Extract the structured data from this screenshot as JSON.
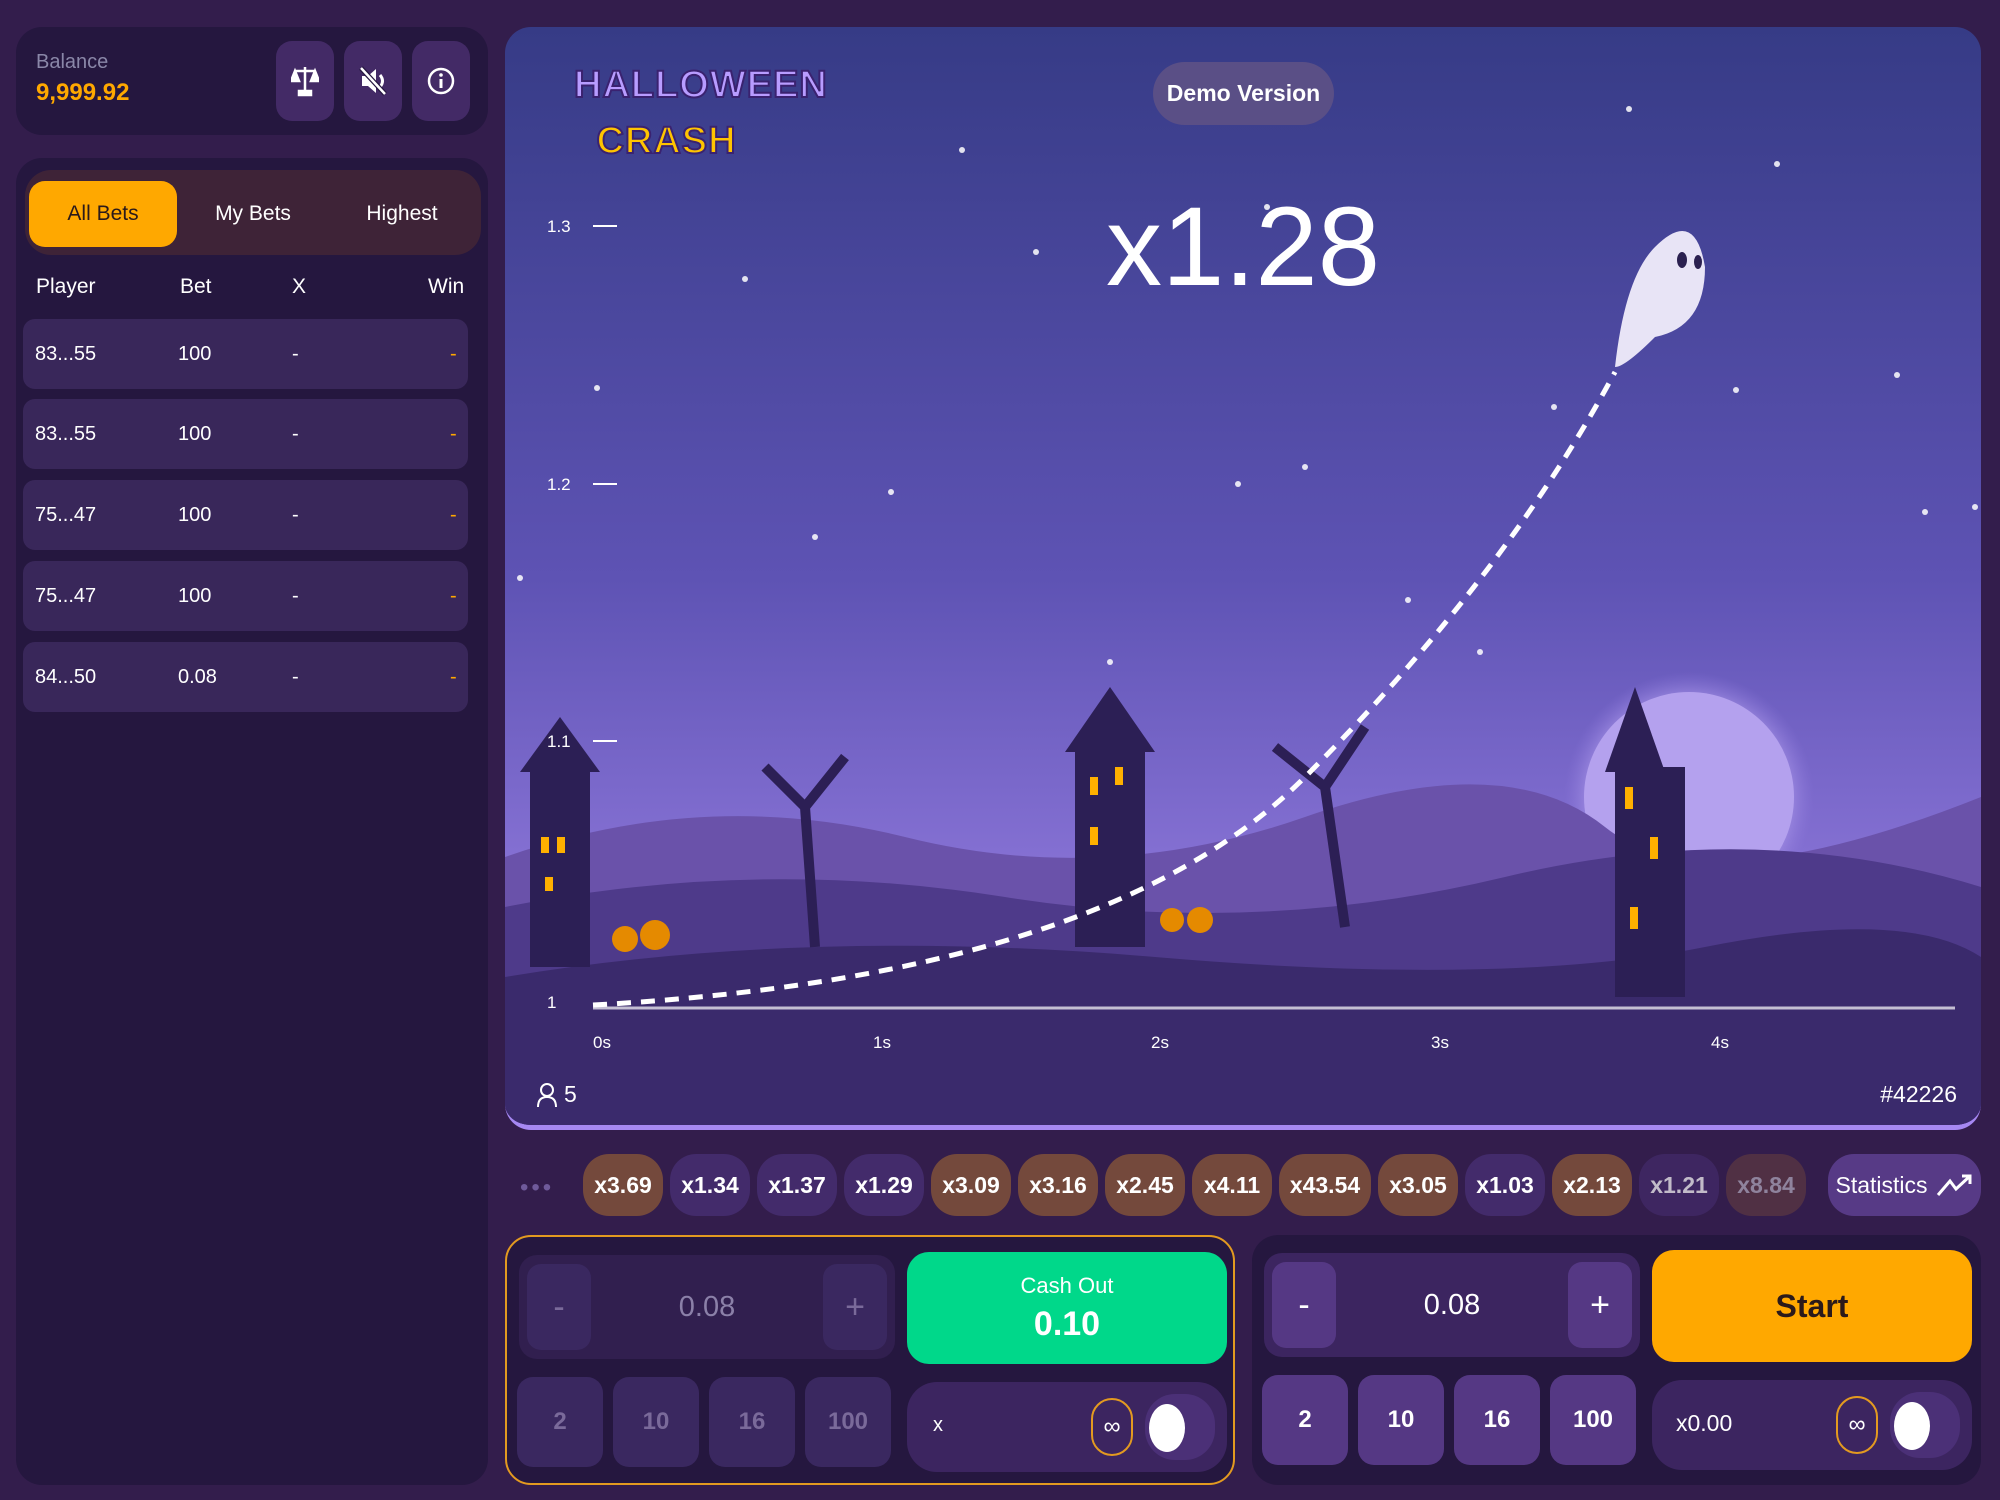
{
  "header": {
    "balance_label": "Balance",
    "balance_value": "9,999.92",
    "icons": [
      "scales-icon",
      "sound-muted-icon",
      "info-icon"
    ]
  },
  "bets": {
    "tabs": [
      {
        "label": "All Bets",
        "active": true
      },
      {
        "label": "My Bets"
      },
      {
        "label": "Highest"
      }
    ],
    "columns": [
      "Player",
      "Bet",
      "X",
      "Win"
    ],
    "rows": [
      {
        "player": "83...55",
        "bet": "100",
        "x": "-",
        "win": "-"
      },
      {
        "player": "83...55",
        "bet": "100",
        "x": "-",
        "win": "-"
      },
      {
        "player": "75...47",
        "bet": "100",
        "x": "-",
        "win": "-"
      },
      {
        "player": "75...47",
        "bet": "100",
        "x": "-",
        "win": "-"
      },
      {
        "player": "84...50",
        "bet": "0.08",
        "x": "-",
        "win": "-"
      }
    ]
  },
  "game": {
    "logo_text": "HALLOWEEN CRASH",
    "demo_label": "Demo Version",
    "multiplier": "x1.28",
    "y_ticks": [
      "1.3",
      "1.2",
      "1.1",
      "1"
    ],
    "x_ticks": [
      "0s",
      "1s",
      "2s",
      "3s",
      "4s"
    ],
    "players": "5",
    "round_id": "#42226"
  },
  "history": {
    "items": [
      {
        "v": "x3.69",
        "t": "high"
      },
      {
        "v": "x1.34",
        "t": "low"
      },
      {
        "v": "x1.37",
        "t": "low"
      },
      {
        "v": "x1.29",
        "t": "low"
      },
      {
        "v": "x3.09",
        "t": "high"
      },
      {
        "v": "x3.16",
        "t": "high"
      },
      {
        "v": "x2.45",
        "t": "high"
      },
      {
        "v": "x4.11",
        "t": "high"
      },
      {
        "v": "x43.54",
        "t": "high"
      },
      {
        "v": "x3.05",
        "t": "high"
      },
      {
        "v": "x1.03",
        "t": "low"
      },
      {
        "v": "x2.13",
        "t": "high"
      },
      {
        "v": "x1.21",
        "t": "low"
      },
      {
        "v": "x8.84",
        "t": "high"
      }
    ],
    "statistics_label": "Statistics"
  },
  "bet1": {
    "minus": "-",
    "plus": "+",
    "amount": "0.08",
    "quick": [
      "2",
      "10",
      "16",
      "100"
    ],
    "cashout_label": "Cash Out",
    "cashout_value": "0.10",
    "auto_value": "x",
    "infinity": "∞"
  },
  "bet2": {
    "minus": "-",
    "plus": "+",
    "amount": "0.08",
    "quick": [
      "2",
      "10",
      "16",
      "100"
    ],
    "start_label": "Start",
    "auto_value": "x0.00",
    "infinity": "∞"
  },
  "colors": {
    "accent": "#ffa800",
    "cashout": "#00d88a",
    "bg": "#331d4c"
  }
}
